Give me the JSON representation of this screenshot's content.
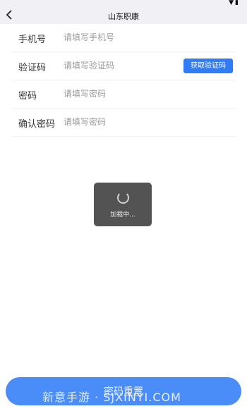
{
  "status_bar": {
    "icons": "▼▮"
  },
  "header": {
    "title": "山东职康",
    "back_icon": "chevron-left-icon"
  },
  "form": {
    "phone": {
      "label": "手机号",
      "placeholder": "请填写手机号"
    },
    "code": {
      "label": "验证码",
      "placeholder": "请填写验证码",
      "button_label": "获取验证码"
    },
    "password": {
      "label": "密码",
      "placeholder": "请填写密码"
    },
    "confirm": {
      "label": "确认密码",
      "placeholder": "请填写密码"
    }
  },
  "loading": {
    "text": "加载中..."
  },
  "footer": {
    "reset_label": "密码重置"
  },
  "watermark": {
    "text": "新意手游 · SJXINYI.COM"
  },
  "colors": {
    "accent": "#2f7cf6",
    "reset_button": "#4a8df8",
    "toast": "#4a4a4a"
  }
}
